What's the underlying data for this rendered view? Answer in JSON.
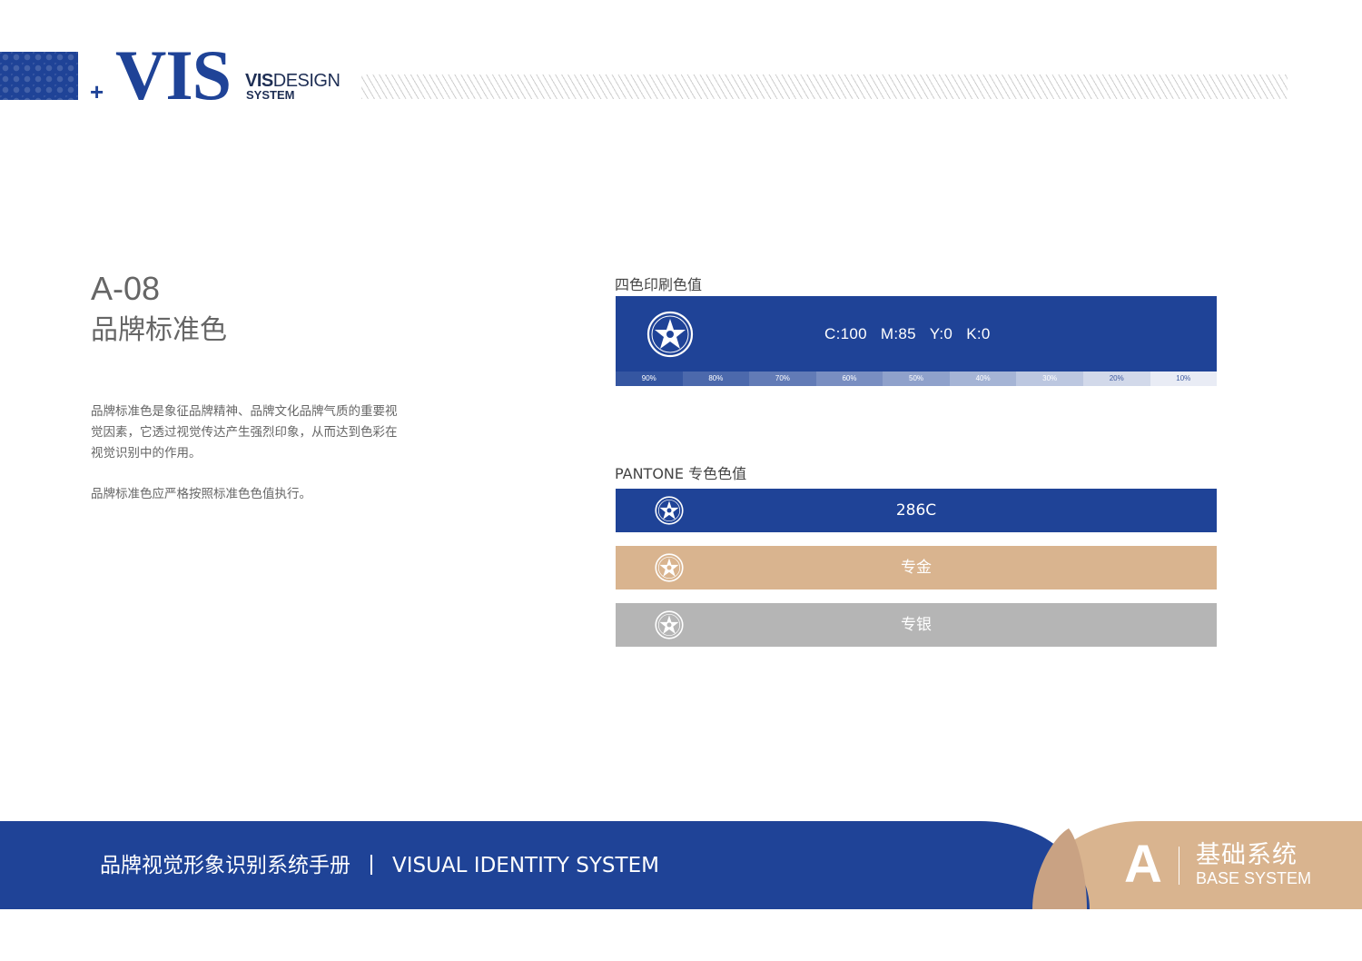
{
  "header": {
    "plus": "+",
    "logo_text": "VIS",
    "sub_bold": "VIS",
    "sub_rest": "DESIGN",
    "sub_line2": "SYSTEM"
  },
  "section": {
    "code": "A-08",
    "title": "品牌标准色",
    "description": "品牌标准色是象征品牌精神、品牌文化品牌气质的重要视觉因素，它透过视觉传达产生强烈印象，从而达到色彩在视觉识别中的作用。",
    "description2": "品牌标准色应严格按照标准色色值执行。"
  },
  "cmyk": {
    "label": "四色印刷色值",
    "value": "C:100   M:85   Y:0   K:0",
    "tints": [
      "90%",
      "80%",
      "70%",
      "60%",
      "50%",
      "40%",
      "30%",
      "20%",
      "10%"
    ],
    "tint_levels": [
      0.9,
      0.8,
      0.7,
      0.6,
      0.5,
      0.4,
      0.3,
      0.2,
      0.1
    ]
  },
  "pantone": {
    "label": "PANTONE 专色色值",
    "bars": [
      {
        "label": "286C",
        "color": "#1f4397"
      },
      {
        "label": "专金",
        "color": "#d9b48f"
      },
      {
        "label": "专银",
        "color": "#b5b5b5"
      }
    ]
  },
  "colors": {
    "brand_blue": "#1f4397",
    "gold": "#d9b48f",
    "silver": "#b5b5b5"
  },
  "footer": {
    "title_cn": "品牌视觉形象识别系统手册",
    "title_en": "VISUAL IDENTITY SYSTEM",
    "section_letter": "A",
    "section_cn": "基础系统",
    "section_en": "BASE SYSTEM"
  }
}
